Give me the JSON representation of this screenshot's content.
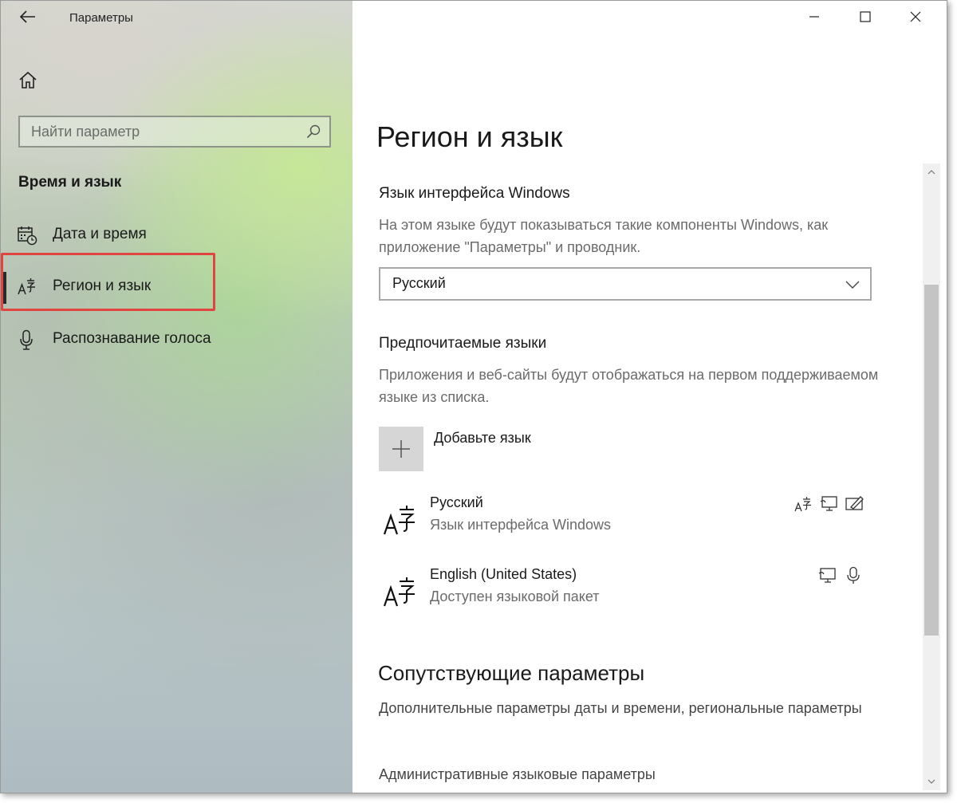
{
  "window": {
    "title": "Параметры",
    "controls": {
      "minimize": "minimize",
      "maximize": "maximize",
      "close": "close"
    }
  },
  "sidebar": {
    "search": {
      "placeholder": "Найти параметр"
    },
    "section_heading": "Время и язык",
    "items": [
      {
        "label": "Дата и время",
        "icon": "calendar-clock-icon",
        "selected": false
      },
      {
        "label": "Регион и язык",
        "icon": "language-icon",
        "selected": true
      },
      {
        "label": "Распознавание голоса",
        "icon": "microphone-icon",
        "selected": false
      }
    ],
    "highlight_color": "#e0463f"
  },
  "main": {
    "title": "Регион и язык",
    "display_language": {
      "heading": "Язык интерфейса Windows",
      "description": "На этом языке будут показываться такие компоненты Windows, как приложение \"Параметры\" и проводник.",
      "selected": "Русский"
    },
    "preferred": {
      "heading": "Предпочитаемые языки",
      "description": "Приложения и веб-сайты будут отображаться на первом поддерживаемом языке из списка.",
      "add_label": "Добавьте язык",
      "languages": [
        {
          "name": "Русский",
          "status": "Язык интерфейса Windows",
          "features": [
            "display-language-icon",
            "text-to-speech-icon",
            "handwriting-icon"
          ]
        },
        {
          "name": "English (United States)",
          "status": "Доступен языковой пакет",
          "features": [
            "text-to-speech-icon",
            "speech-recognition-icon"
          ]
        }
      ]
    },
    "related": {
      "heading": "Сопутствующие параметры",
      "links": [
        "Дополнительные параметры даты и времени, региональные параметры",
        "Административные языковые параметры"
      ]
    }
  }
}
